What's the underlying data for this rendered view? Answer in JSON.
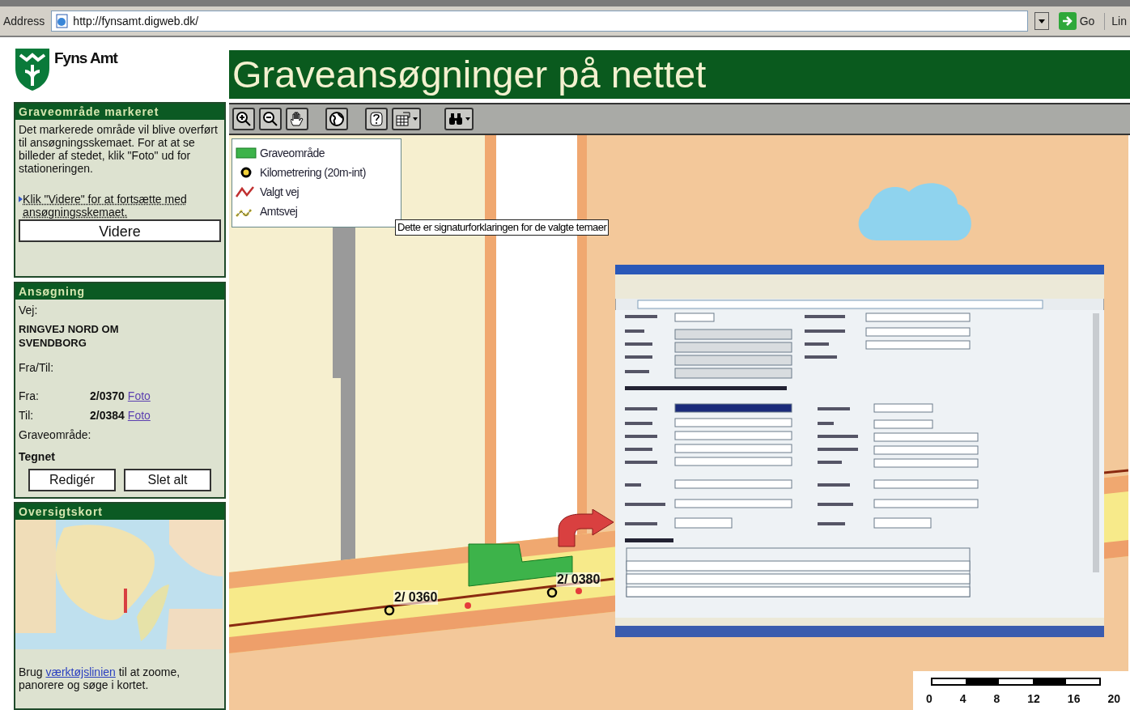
{
  "address_bar": {
    "label": "Address",
    "url": "http://fynsamt.digweb.dk/",
    "go": "Go",
    "links": "Lin"
  },
  "logo": {
    "name": "Fyns Amt"
  },
  "title": "Graveansøgninger på nettet",
  "marked_panel": {
    "title": "Graveområde markeret",
    "text": "Det markerede område vil blive overført til ansøgningsskemaet. For at at se billeder af stedet, klik \"Foto\" ud for stationeringen.",
    "hint": "Klik \"Videre\" for at fortsætte med ansøgningsskemaet.",
    "button": "Videre"
  },
  "application_panel": {
    "title": "Ansøgning",
    "road_label": "Vej:",
    "road": "RINGVEJ NORD OM SVENDBORG",
    "from_to_label": "Fra/Til:",
    "stations": [
      {
        "label": "Fra:",
        "value": "2/0370",
        "link": "Foto"
      },
      {
        "label": "Til:",
        "value": "2/0384",
        "link": "Foto"
      }
    ],
    "area_label": "Graveområde:",
    "area_value": "Tegnet",
    "buttons": [
      "Redigér",
      "Slet alt"
    ]
  },
  "overview_panel": {
    "title": "Oversigtskort",
    "text_before": "Brug",
    "link": "værktøjslinien",
    "text_after": "til at zoome, panorere og søge i kortet."
  },
  "legend": {
    "items": [
      {
        "kind": "area",
        "label": "Graveområde"
      },
      {
        "kind": "point",
        "label": "Kilometrering (20m-int)"
      },
      {
        "kind": "selected-road",
        "label": "Valgt vej"
      },
      {
        "kind": "county-road",
        "label": "Amtsvej"
      }
    ]
  },
  "tooltip": "Dette er signaturforklaringen for de valgte temaer",
  "map": {
    "labels": [
      "2/ 0360",
      "2/ 0380"
    ]
  },
  "scale": {
    "ticks": [
      "0",
      "4",
      "8",
      "12",
      "16",
      "20"
    ]
  }
}
